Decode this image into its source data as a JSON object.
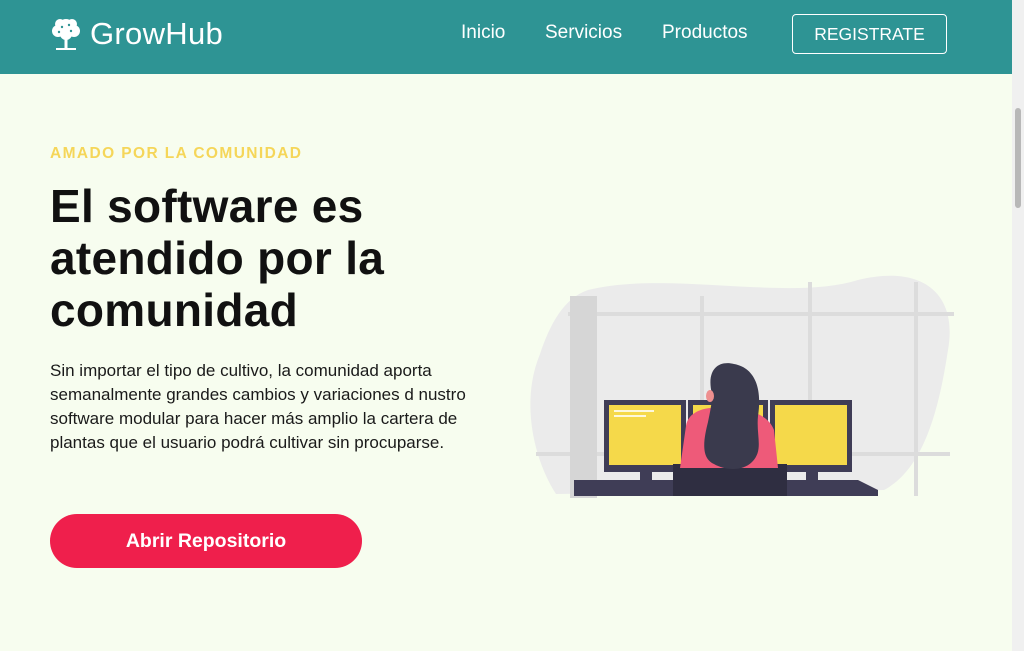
{
  "brand": {
    "name": "GrowHub",
    "logo_icon": "tree-icon"
  },
  "nav": {
    "inicio": "Inicio",
    "servicios": "Servicios",
    "productos": "Productos",
    "register": "REGISTRATE"
  },
  "hero": {
    "eyebrow": "AMADO POR LA COMUNIDAD",
    "title": "El software es atendido por la comunidad",
    "text": "Sin importar el tipo de cultivo, la comunidad aporta semanalmente grandes cambios y variaciones d nustro software modular para hacer más amplio la cartera de plantas que el usuario podrá cultivar sin procuparse.",
    "cta": "Abrir Repositorio"
  },
  "colors": {
    "navbar": "#2e9494",
    "background": "#f7fdef",
    "eyebrow": "#f5d659",
    "cta": "#ef1f4c",
    "monitor": "#f5d94a",
    "shirt": "#ee5a79",
    "hair": "#3a3a4d"
  }
}
